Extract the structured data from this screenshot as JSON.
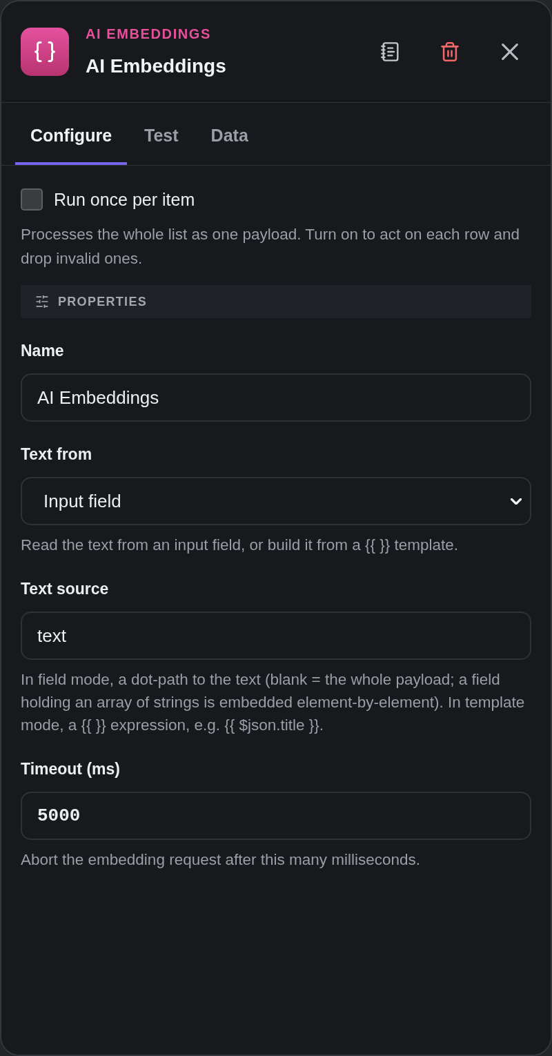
{
  "header": {
    "category": "AI EMBEDDINGS",
    "title": "AI Embeddings"
  },
  "tabs": [
    {
      "label": "Configure",
      "selected": true
    },
    {
      "label": "Test",
      "selected": false
    },
    {
      "label": "Data",
      "selected": false
    }
  ],
  "run_once": {
    "label": "Run once per item",
    "checked": false,
    "hint": "Processes the whole list as one payload. Turn on to act on each row and drop invalid ones."
  },
  "section": {
    "title": "PROPERTIES"
  },
  "fields": [
    {
      "kind": "text",
      "label": "Name",
      "value": "AI Embeddings"
    },
    {
      "kind": "select",
      "label": "Text from",
      "value": "Input field",
      "hint": "Read the text from an input field, or build it from a {{ }} template."
    },
    {
      "kind": "text",
      "label": "Text source",
      "value": "text",
      "hint": "In field mode, a dot-path to the text (blank = the whole payload; a field holding an array of strings is embedded element-by-element). In template mode, a {{ }} expression, e.g. {{ $json.title }}."
    },
    {
      "kind": "number",
      "label": "Timeout (ms)",
      "value": "5000",
      "hint": "Abort the embedding request after this many milliseconds."
    }
  ]
}
